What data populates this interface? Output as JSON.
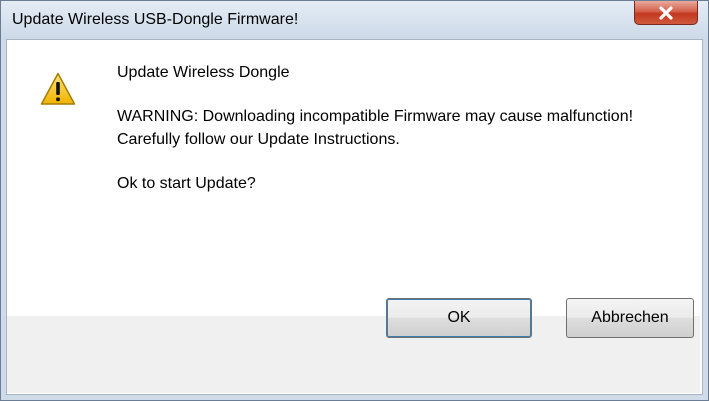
{
  "window": {
    "title": "Update Wireless USB-Dongle Firmware!",
    "close_icon": "close-icon"
  },
  "message": {
    "icon": "warning-icon",
    "heading": "Update Wireless Dongle",
    "warning": "WARNING: Downloading incompatible Firmware may cause malfunction!",
    "instructions": "Carefully follow our Update Instructions.",
    "question": "Ok to start Update?"
  },
  "buttons": {
    "ok_label": "OK",
    "cancel_label": "Abbrechen"
  },
  "colors": {
    "close_button": "#c94a30",
    "warning_fill": "#f5c518",
    "default_button_border": "#3c7fb1"
  }
}
